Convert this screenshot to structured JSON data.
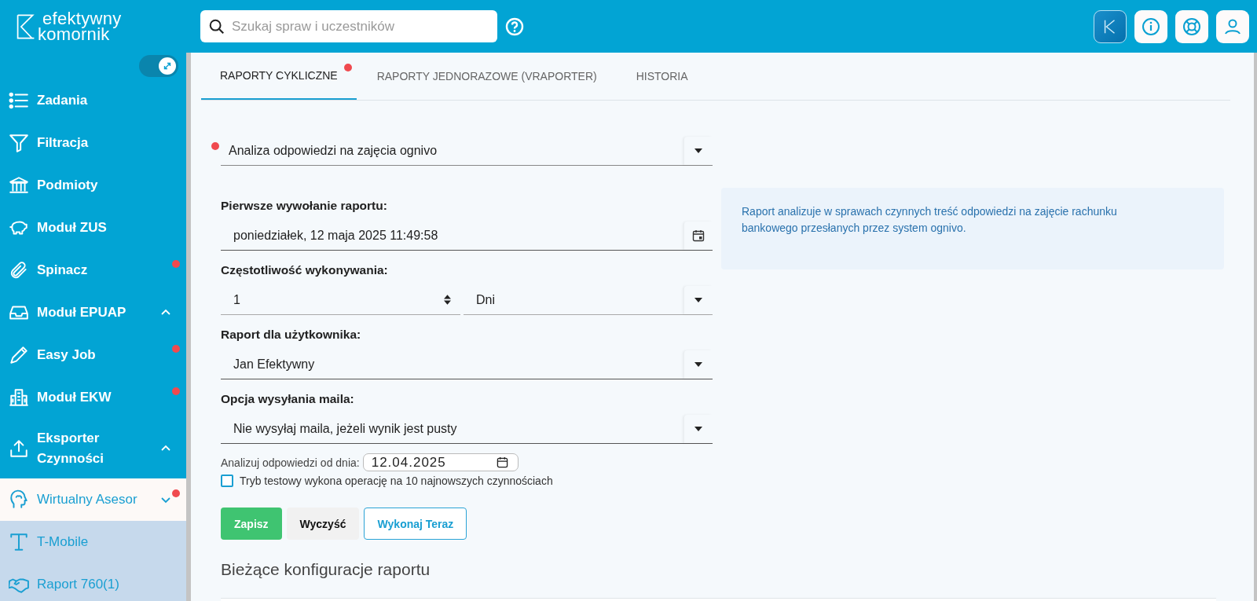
{
  "header": {
    "logo": {
      "line_1": "efektywny",
      "line_2": "komornik"
    },
    "search": {
      "placeholder": "Szukaj spraw i uczestników"
    }
  },
  "sidebar": {
    "toggle": {
      "on": true
    },
    "items": [
      {
        "label": "Zadania",
        "kind": "link",
        "notification": false,
        "selected": false
      },
      {
        "label": "Filtracja",
        "kind": "link",
        "notification": false,
        "selected": false
      },
      {
        "label": "Podmioty",
        "kind": "link",
        "notification": false,
        "selected": false
      },
      {
        "label": "Moduł ZUS",
        "kind": "link",
        "notification": false,
        "selected": false
      },
      {
        "label": "Spinacz",
        "kind": "link",
        "notification": true,
        "selected": false
      },
      {
        "label": "Moduł EPUAP",
        "kind": "group",
        "expanded": false,
        "notification": false,
        "selected": false
      },
      {
        "label": "Easy Job",
        "kind": "link",
        "notification": true,
        "selected": false
      },
      {
        "label": "Moduł EKW",
        "kind": "link",
        "notification": true,
        "selected": false
      },
      {
        "label": "Eksporter Czynności",
        "kind": "group",
        "expanded": false,
        "notification": false,
        "selected": false
      },
      {
        "label": "Wirtualny Asesor",
        "kind": "group",
        "expanded": true,
        "notification": true,
        "selected": true,
        "children": [
          {
            "label": "T-Mobile",
            "selected": false
          },
          {
            "label": "Raport 760(1)",
            "selected": false
          }
        ]
      }
    ]
  },
  "tabs": [
    {
      "label": "RAPORTY CYKLICZNE",
      "selected": true,
      "notification": true
    },
    {
      "label": "RAPORTY JEDNORAZOWE (VRAPORTER)",
      "selected": false,
      "notification": false
    },
    {
      "label": "HISTORIA",
      "selected": false,
      "notification": false
    }
  ],
  "form": {
    "report": {
      "value": "Analiza odpowiedzi na zajęcia ognivo",
      "notification": true
    },
    "first_run": {
      "label": "Pierwsze wywołanie raportu:",
      "value": "poniedziałek, 12 maja 2025 11:49:58"
    },
    "frequency": {
      "label": "Częstotliwość wykonywania:",
      "value": "1",
      "unit": "Dni"
    },
    "user": {
      "label": "Raport dla użytkownika:",
      "value": "Jan Efektywny"
    },
    "mail_option": {
      "label": "Opcja wysyłania maila:",
      "value": "Nie wysyłaj maila, jeżeli wynik jest pusty"
    },
    "since": {
      "label": "Analizuj odpowiedzi od dnia:",
      "value": "12.04.2025"
    },
    "test_mode": {
      "label": "Tryb testowy wykona operację na 10 najnowszych czynnościach",
      "checked": false
    }
  },
  "info": "Raport analizuje w sprawach czynnych treść odpowiedzi na zajęcie rachunku bankowego przesłanych przez system ognivo.",
  "buttons": [
    {
      "label": "Zapisz",
      "kind": "primary"
    },
    {
      "label": "Wyczyść",
      "kind": "secondary"
    },
    {
      "label": "Wykonaj Teraz",
      "kind": "outline"
    }
  ],
  "configs_title": "Bieżące konfiguracje raportu"
}
